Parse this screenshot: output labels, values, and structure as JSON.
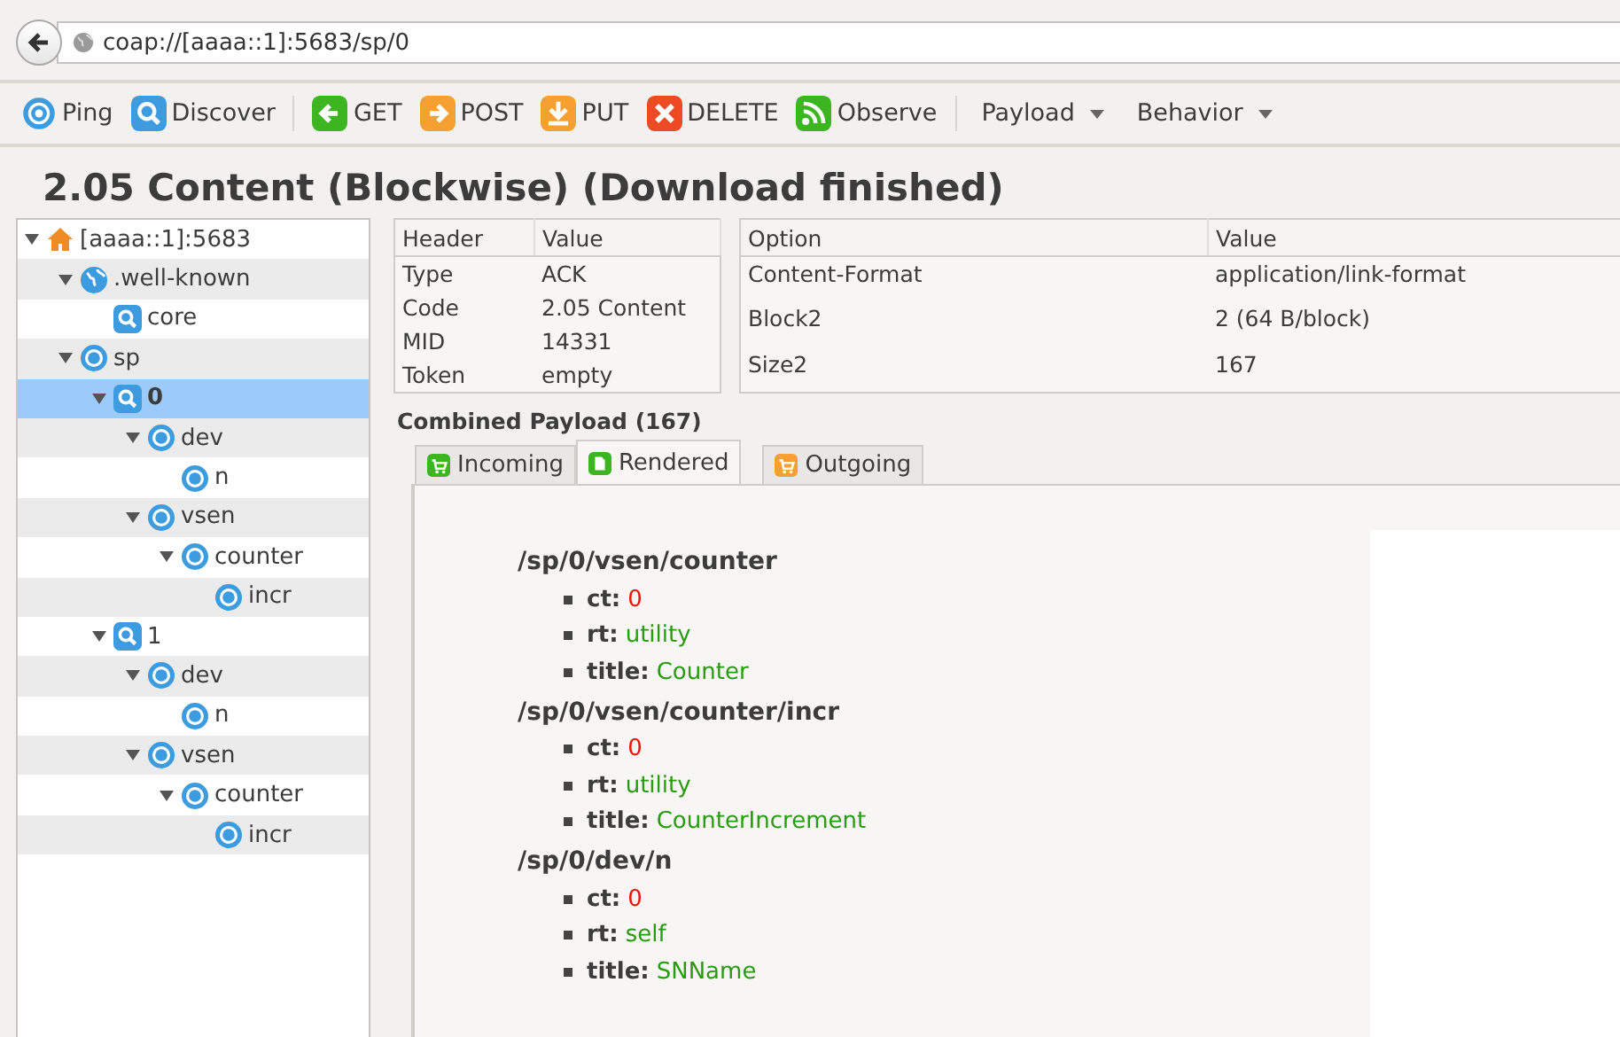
{
  "address_bar": {
    "url": "coap://[aaaa::1]:5683/sp/0"
  },
  "toolbar": {
    "groups": [
      [
        {
          "kind": "ping",
          "label": "Ping"
        },
        {
          "kind": "discover",
          "label": "Discover"
        }
      ],
      [
        {
          "kind": "get",
          "label": "GET"
        },
        {
          "kind": "post",
          "label": "POST"
        },
        {
          "kind": "put",
          "label": "PUT"
        },
        {
          "kind": "delete",
          "label": "DELETE"
        },
        {
          "kind": "observe",
          "label": "Observe"
        }
      ],
      [
        {
          "kind": "menu",
          "label": "Payload"
        },
        {
          "kind": "menu",
          "label": "Behavior"
        }
      ]
    ]
  },
  "status_title": "2.05 Content (Blockwise) (Download finished)",
  "tree": [
    {
      "label": "[aaaa::1]:5683",
      "kind": "home",
      "selected": false,
      "expanded": true,
      "children": [
        {
          "label": ".well-known",
          "kind": "globe",
          "selected": false,
          "expanded": true,
          "children": [
            {
              "label": "core",
              "kind": "search",
              "selected": false
            }
          ]
        },
        {
          "label": "sp",
          "kind": "resource",
          "selected": false,
          "expanded": true,
          "children": [
            {
              "label": "0",
              "kind": "search",
              "selected": true,
              "expanded": true,
              "children": [
                {
                  "label": "dev",
                  "kind": "resource",
                  "selected": false,
                  "expanded": true,
                  "children": [
                    {
                      "label": "n",
                      "kind": "resource",
                      "selected": false
                    }
                  ]
                },
                {
                  "label": "vsen",
                  "kind": "resource",
                  "selected": false,
                  "expanded": true,
                  "children": [
                    {
                      "label": "counter",
                      "kind": "resource",
                      "selected": false,
                      "expanded": true,
                      "children": [
                        {
                          "label": "incr",
                          "kind": "resource",
                          "selected": false
                        }
                      ]
                    }
                  ]
                }
              ]
            },
            {
              "label": "1",
              "kind": "search",
              "selected": false,
              "expanded": true,
              "children": [
                {
                  "label": "dev",
                  "kind": "resource",
                  "selected": false,
                  "expanded": true,
                  "children": [
                    {
                      "label": "n",
                      "kind": "resource",
                      "selected": false
                    }
                  ]
                },
                {
                  "label": "vsen",
                  "kind": "resource",
                  "selected": false,
                  "expanded": true,
                  "children": [
                    {
                      "label": "counter",
                      "kind": "resource",
                      "selected": false,
                      "expanded": true,
                      "children": [
                        {
                          "label": "incr",
                          "kind": "resource",
                          "selected": false
                        }
                      ]
                    }
                  ]
                }
              ]
            }
          ]
        }
      ]
    }
  ],
  "header_table": {
    "columns": [
      "Header",
      "Value"
    ],
    "rows": [
      [
        "Type",
        "ACK"
      ],
      [
        "Code",
        "2.05 Content"
      ],
      [
        "MID",
        "14331"
      ],
      [
        "Token",
        "empty"
      ]
    ]
  },
  "option_table": {
    "columns": [
      "Option",
      "Value"
    ],
    "rows": [
      [
        "Content-Format",
        "application/link-format"
      ],
      [
        "Block2",
        "2 (64 B/block)"
      ],
      [
        "Size2",
        "167"
      ]
    ]
  },
  "payload_label": "Combined Payload (167)",
  "payload_tabs": [
    {
      "label": "Incoming",
      "kind": "incoming",
      "selected": false
    },
    {
      "label": "Rendered",
      "kind": "rendered",
      "selected": true
    },
    {
      "label": "Outgoing",
      "kind": "outgoing",
      "selected": false
    }
  ],
  "resources": [
    {
      "path": "/sp/0/vsen/counter",
      "attributes": [
        {
          "key": "ct:",
          "value": "0",
          "kind": "number"
        },
        {
          "key": "rt:",
          "value": "utility",
          "kind": "string"
        },
        {
          "key": "title:",
          "value": "Counter",
          "kind": "string"
        }
      ]
    },
    {
      "path": "/sp/0/vsen/counter/incr",
      "attributes": [
        {
          "key": "ct:",
          "value": "0",
          "kind": "number"
        },
        {
          "key": "rt:",
          "value": "utility",
          "kind": "string"
        },
        {
          "key": "title:",
          "value": "CounterIncrement",
          "kind": "string"
        }
      ]
    },
    {
      "path": "/sp/0/dev/n",
      "attributes": [
        {
          "key": "ct:",
          "value": "0",
          "kind": "number"
        },
        {
          "key": "rt:",
          "value": "self",
          "kind": "string"
        },
        {
          "key": "title:",
          "value": "SNName",
          "kind": "string"
        }
      ]
    }
  ]
}
